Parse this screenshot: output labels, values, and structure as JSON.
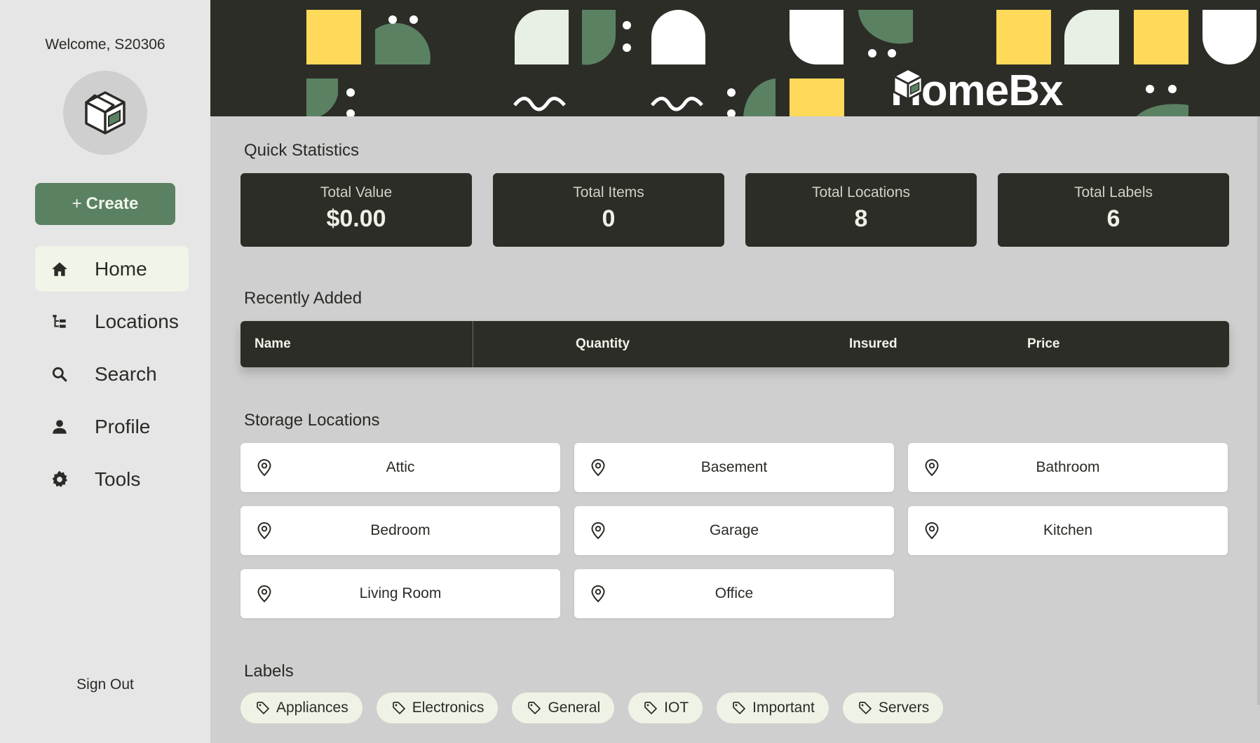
{
  "sidebar": {
    "welcome": "Welcome, S20306",
    "create_label": "Create",
    "create_plus": "+",
    "nav": [
      {
        "label": "Home",
        "icon": "home-icon",
        "active": true
      },
      {
        "label": "Locations",
        "icon": "tree-icon"
      },
      {
        "label": "Search",
        "icon": "search-icon"
      },
      {
        "label": "Profile",
        "icon": "person-icon"
      },
      {
        "label": "Tools",
        "icon": "gear-icon"
      }
    ],
    "sign_out": "Sign Out"
  },
  "banner": {
    "brand_prefix": "HomeB",
    "brand_suffix": "x"
  },
  "stats": {
    "title": "Quick Statistics",
    "items": [
      {
        "label": "Total Value",
        "value": "$0.00"
      },
      {
        "label": "Total Items",
        "value": "0"
      },
      {
        "label": "Total Locations",
        "value": "8"
      },
      {
        "label": "Total Labels",
        "value": "6"
      }
    ]
  },
  "recent": {
    "title": "Recently Added",
    "columns": {
      "name": "Name",
      "quantity": "Quantity",
      "insured": "Insured",
      "price": "Price"
    }
  },
  "locations": {
    "title": "Storage Locations",
    "items": [
      "Attic",
      "Basement",
      "Bathroom",
      "Bedroom",
      "Garage",
      "Kitchen",
      "Living Room",
      "Office"
    ]
  },
  "labels": {
    "title": "Labels",
    "items": [
      "Appliances",
      "Electronics",
      "General",
      "IOT",
      "Important",
      "Servers"
    ]
  },
  "colors": {
    "accent_green": "#5b8163",
    "dark": "#2c2d27",
    "yellow": "#ffd95a",
    "pale_green": "#eef3e6"
  }
}
